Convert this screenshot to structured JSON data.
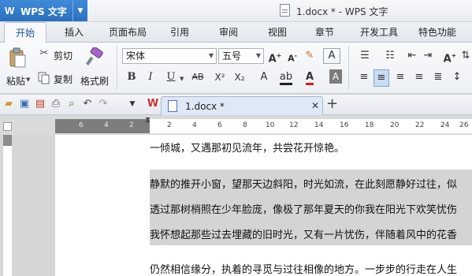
{
  "app": {
    "logo": "W",
    "name": "WPS 文字",
    "window_title": "1.docx * - WPS 文字"
  },
  "tabs": [
    "开始",
    "插入",
    "页面布局",
    "引用",
    "审阅",
    "视图",
    "章节",
    "开发工具",
    "特色功能"
  ],
  "ribbon": {
    "paste": "粘贴",
    "cut": "剪切",
    "copy": "复制",
    "format_painter": "格式刷",
    "font_name": "宋体",
    "font_size": "五号"
  },
  "document_tab": {
    "title": "1.docx *"
  },
  "ruler": {
    "left_marks": [
      "6",
      "4",
      "2"
    ],
    "right_marks": [
      "2",
      "4",
      "6",
      "8",
      "10",
      "12",
      "14",
      "16",
      "18",
      "20",
      "22",
      "24",
      "26"
    ]
  },
  "document": {
    "paragraphs": [
      "一倾城，又遇那初见流年，共尝花开惊艳。",
      "静默的推开小窗，望那天边斜阳，时光如流，在此刻愿静好过往，似",
      "透过那树梢照在少年脸庞，像极了那年夏天的你我在阳光下欢笑忧伤",
      "我怀想起那些过去埋藏的旧时光，又有一片忧伤，伴随着风中的花香",
      "仍然相信缘分，执着的寻觅与过往相像的地方。一步步的行走在人生"
    ]
  }
}
